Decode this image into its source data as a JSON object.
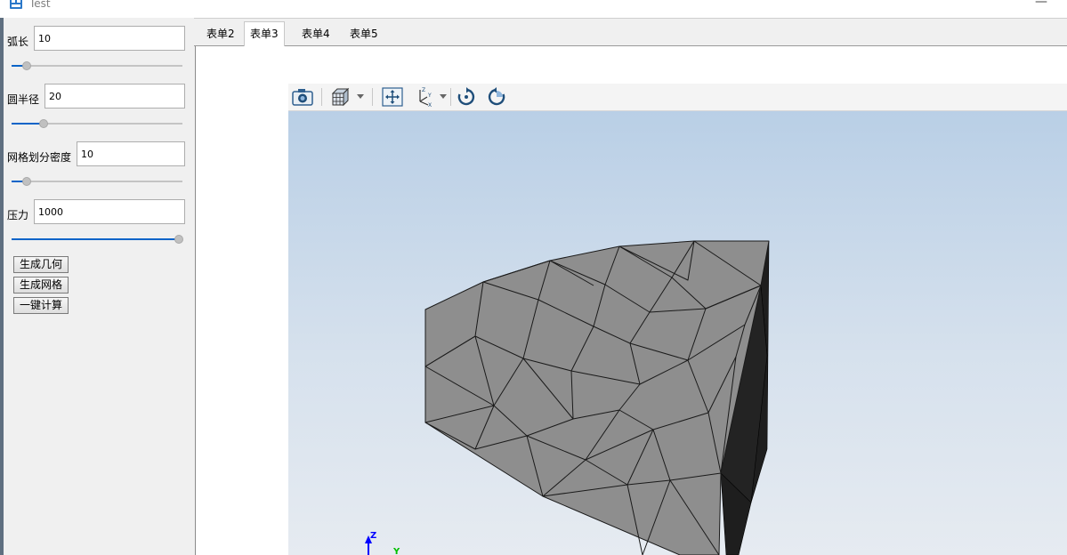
{
  "window": {
    "title": "Test",
    "minimize_glyph": "—"
  },
  "params": [
    {
      "label": "弧长",
      "value": "10",
      "slider_fraction": 0.1
    },
    {
      "label": "圆半径",
      "value": "20",
      "slider_fraction": 0.2
    },
    {
      "label": "网格划分密度",
      "value": "10",
      "slider_fraction": 0.1
    },
    {
      "label": "压力",
      "value": "1000",
      "slider_fraction": 1.0
    }
  ],
  "buttons": {
    "geometry": "生成几何",
    "mesh": "生成网格",
    "compute": "一键计算"
  },
  "tabs": [
    {
      "label": "表单2",
      "active": false
    },
    {
      "label": "表单3",
      "active": true
    },
    {
      "label": "表单4",
      "active": false
    },
    {
      "label": "表单5",
      "active": false
    }
  ],
  "viewer_toolbar": {
    "icons": [
      "camera-icon",
      "view-cube-icon",
      "fit-all-icon",
      "axes-icon",
      "rotate-cw-icon",
      "rotate-ccw-icon"
    ]
  },
  "axis_triad": {
    "z_label": "Z",
    "y_label": "Y"
  },
  "colors": {
    "accent": "#0a64c8",
    "mesh_face": "#8e8e8e",
    "mesh_side": "#1e1e1e",
    "viewport_top": "#b9cfe6"
  }
}
